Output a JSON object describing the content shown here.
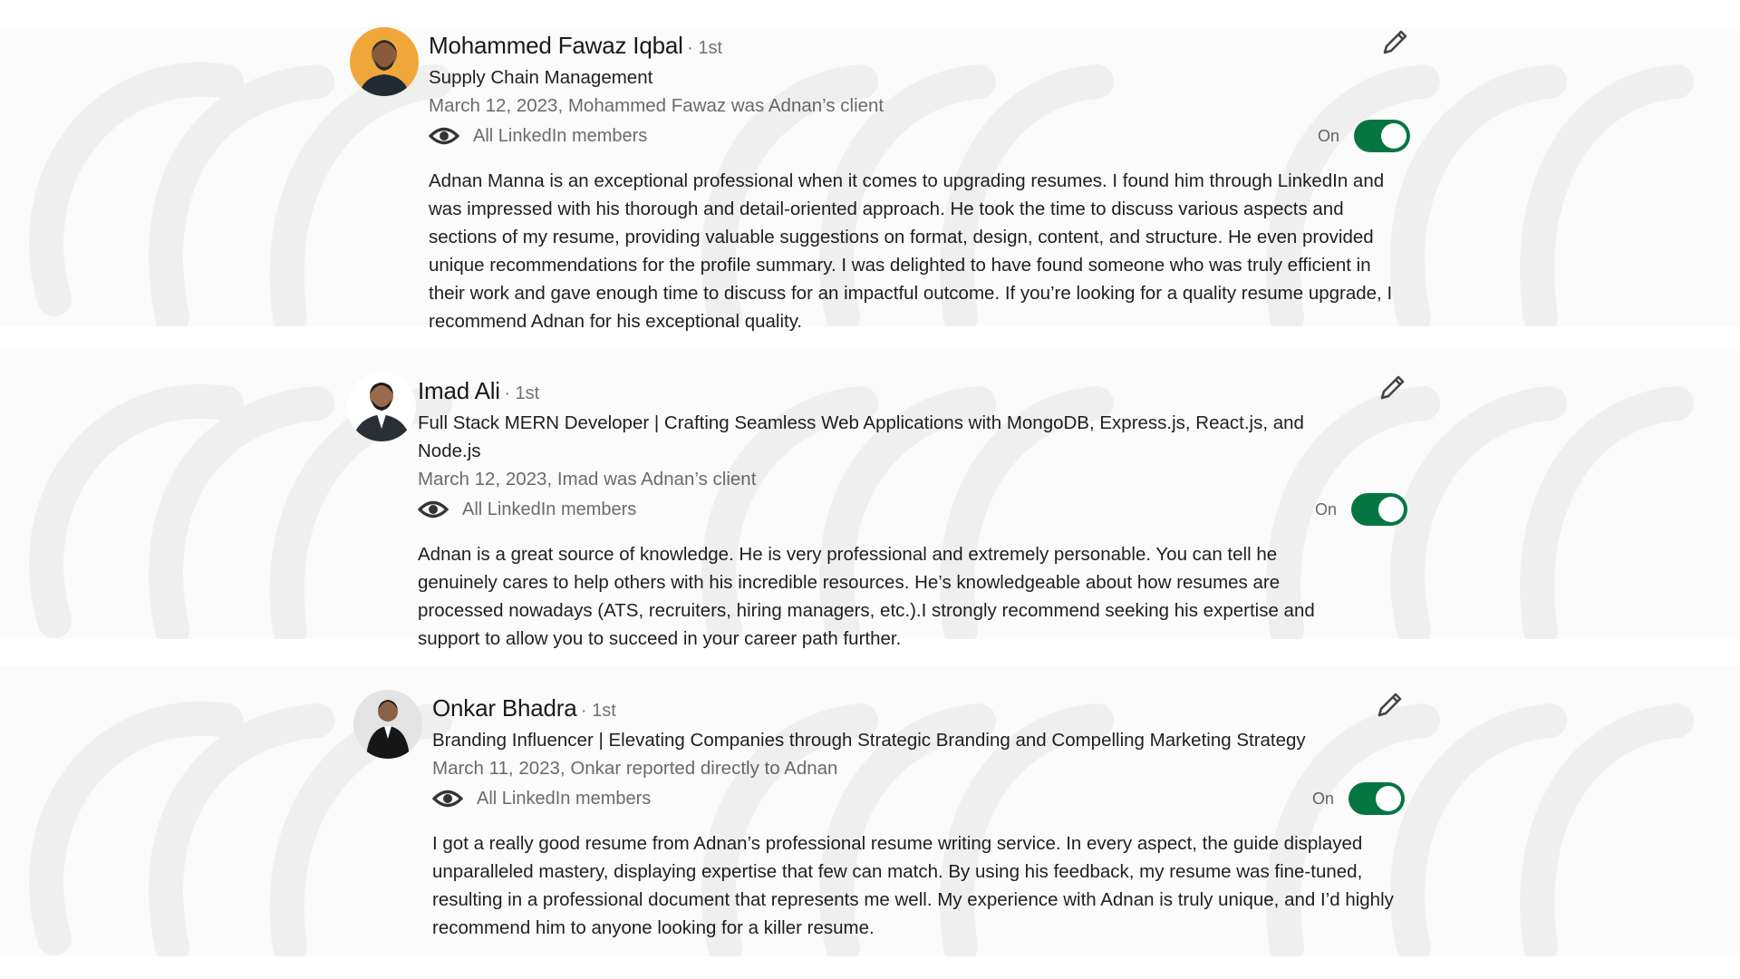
{
  "recommendations": [
    {
      "name": "Mohammed Fawaz Iqbal",
      "degree": "· 1st",
      "headline": "Supply Chain Management",
      "meta": "March 12, 2023, Mohammed Fawaz was Adnan’s client",
      "visibility": "All LinkedIn members",
      "toggle_label": "On",
      "toggle_state": "on",
      "text": "Adnan Manna is an exceptional professional when it comes to upgrading resumes. I found him through LinkedIn and was impressed with his thorough and detail-oriented approach. He took the time to discuss various aspects and sections of my resume, providing valuable suggestions on format, design, content, and structure. He even provided unique recommendations for the profile summary. I was delighted to have found someone who was truly efficient in their work and gave enough time to discuss for an impactful outcome. If you’re looking for a quality resume upgrade, I recommend Adnan for his exceptional quality."
    },
    {
      "name": "Imad Ali",
      "degree": "· 1st",
      "headline": "Full Stack MERN Developer | Crafting Seamless Web Applications with MongoDB, Express.js, React.js, and Node.js",
      "meta": "March 12, 2023, Imad was Adnan’s client",
      "visibility": "All LinkedIn members",
      "toggle_label": "On",
      "toggle_state": "on",
      "text": "Adnan is a great source of knowledge. He is very professional and extremely personable. You can tell he genuinely cares to help others with his incredible resources. He’s knowledgeable about how resumes are processed nowadays (ATS, recruiters, hiring managers, etc.).I strongly recommend seeking his expertise and support to allow you to succeed in your career path further."
    },
    {
      "name": "Onkar Bhadra",
      "degree": "· 1st",
      "headline": "Branding Influencer | Elevating Companies through Strategic Branding and Compelling Marketing Strategy",
      "meta": "March 11, 2023, Onkar reported directly to Adnan",
      "visibility": "All LinkedIn members",
      "toggle_label": "On",
      "toggle_state": "on",
      "text": "I got a really good resume from Adnan’s professional resume writing service. In every aspect, the guide displayed unparalleled mastery, displaying expertise that few can match. By using his feedback, my resume was fine-tuned, resulting in a professional document that represents me well. My experience with Adnan is truly unique, and I’d highly recommend him to anyone looking for a killer resume."
    }
  ],
  "colors": {
    "toggle_on": "#057642",
    "background_band": "#f9f9f9",
    "watermark": "#eeeeee"
  },
  "icons": {
    "visibility": "eye-icon",
    "edit": "pencil-icon"
  }
}
